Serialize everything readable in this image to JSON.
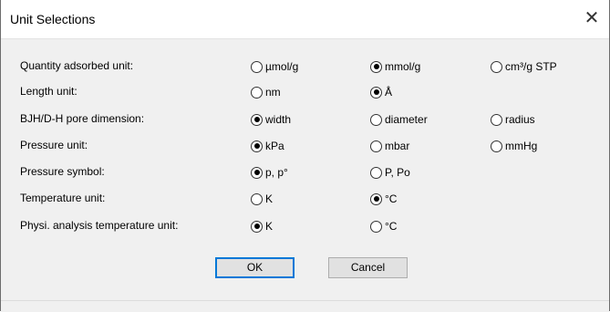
{
  "dialog": {
    "title": "Unit Selections"
  },
  "rows": [
    {
      "label": "Quantity adsorbed unit:",
      "options": [
        {
          "text": "µmol/g",
          "checked": false
        },
        {
          "text": "mmol/g",
          "checked": true
        },
        {
          "text": "cm³/g STP",
          "checked": false
        }
      ]
    },
    {
      "label": "Length unit:",
      "options": [
        {
          "text": "nm",
          "checked": false
        },
        {
          "text": "Å",
          "checked": true
        }
      ]
    },
    {
      "label": "BJH/D-H pore dimension:",
      "options": [
        {
          "text": "width",
          "checked": true
        },
        {
          "text": "diameter",
          "checked": false
        },
        {
          "text": "radius",
          "checked": false
        }
      ]
    },
    {
      "label": "Pressure unit:",
      "options": [
        {
          "text": "kPa",
          "checked": true
        },
        {
          "text": "mbar",
          "checked": false
        },
        {
          "text": "mmHg",
          "checked": false
        }
      ]
    },
    {
      "label": "Pressure symbol:",
      "options": [
        {
          "text": "p, p°",
          "checked": true
        },
        {
          "text": "P, Po",
          "checked": false
        }
      ]
    },
    {
      "label": "Temperature unit:",
      "options": [
        {
          "text": "K",
          "checked": false
        },
        {
          "text": "°C",
          "checked": true
        }
      ]
    },
    {
      "label": "Physi. analysis temperature unit:",
      "options": [
        {
          "text": "K",
          "checked": true
        },
        {
          "text": "°C",
          "checked": false
        }
      ]
    }
  ],
  "buttons": {
    "ok": "OK",
    "cancel": "Cancel"
  }
}
